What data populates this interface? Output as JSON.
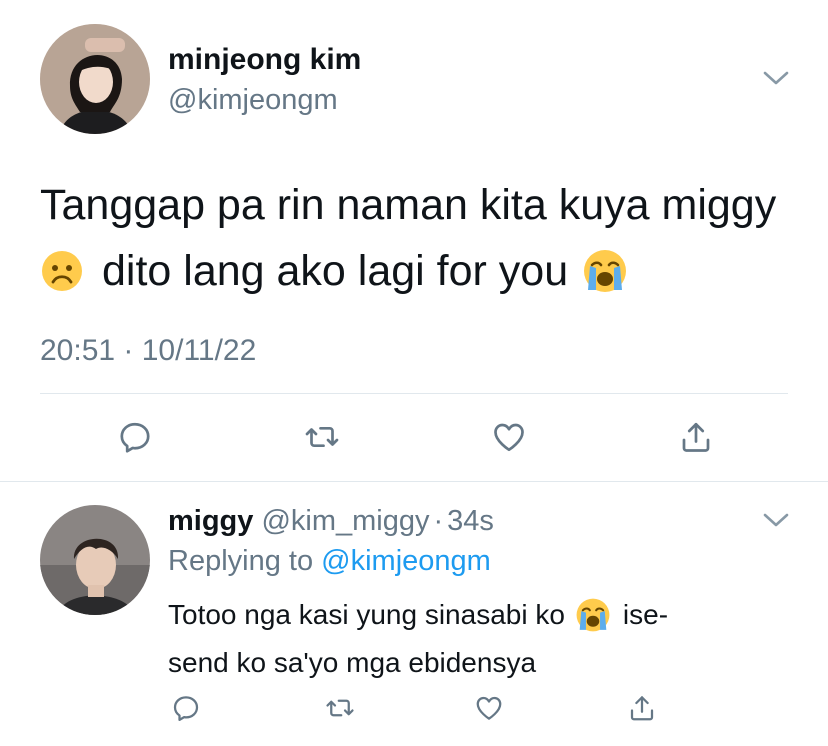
{
  "main_tweet": {
    "author_name": "minjeong kim",
    "author_handle": "@kimjeongm",
    "text_line1": "Tanggap pa rin naman kita kuya miggy",
    "text_line2": "dito lang ako lagi for you",
    "timestamp": "20:51 · 10/11/22",
    "avatar_icon": "avatar-photo-icon",
    "actions": [
      "reply-icon",
      "retweet-icon",
      "like-icon",
      "share-icon"
    ]
  },
  "reply_tweet": {
    "author_name": "miggy",
    "author_handle": "@kim_miggy",
    "separator": "·",
    "time_ago": "34s",
    "replying_to_label": "Replying to",
    "replying_to_handle": "@kimjeongm",
    "text_line1": "Totoo nga kasi yung sinasabi ko",
    "text_line1_suffix": "ise-",
    "text_line2": "send ko sa'yo mga ebidensya",
    "actions": [
      "reply-icon",
      "retweet-icon",
      "like-icon",
      "share-icon"
    ]
  },
  "colors": {
    "text": "#0f1419",
    "muted": "#657786",
    "link": "#1d9bf0",
    "divider": "#e1e8ed"
  }
}
